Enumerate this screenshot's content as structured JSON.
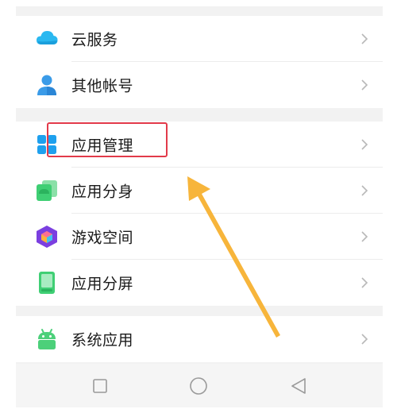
{
  "menu": {
    "groups": [
      {
        "items": [
          {
            "label": "云服务",
            "icon": "cloud-icon"
          },
          {
            "label": "其他帐号",
            "icon": "user-icon"
          }
        ]
      },
      {
        "items": [
          {
            "label": "应用管理",
            "icon": "app-grid-icon",
            "highlighted": true
          },
          {
            "label": "应用分身",
            "icon": "app-clone-icon"
          },
          {
            "label": "游戏空间",
            "icon": "game-space-icon"
          },
          {
            "label": "应用分屏",
            "icon": "split-screen-icon"
          }
        ]
      },
      {
        "items": [
          {
            "label": "系统应用",
            "icon": "android-icon"
          }
        ]
      }
    ]
  },
  "navbar": {
    "buttons": [
      "recent-apps",
      "home",
      "back"
    ]
  },
  "colors": {
    "highlight_border": "#e23a4a",
    "arrow": "#f7b53b",
    "cloud": "#2ab8f0",
    "user": "#3a9be8",
    "app_grid": "#1ea0ee",
    "android": "#4cd07a",
    "game_space": "#7b3fe0"
  }
}
